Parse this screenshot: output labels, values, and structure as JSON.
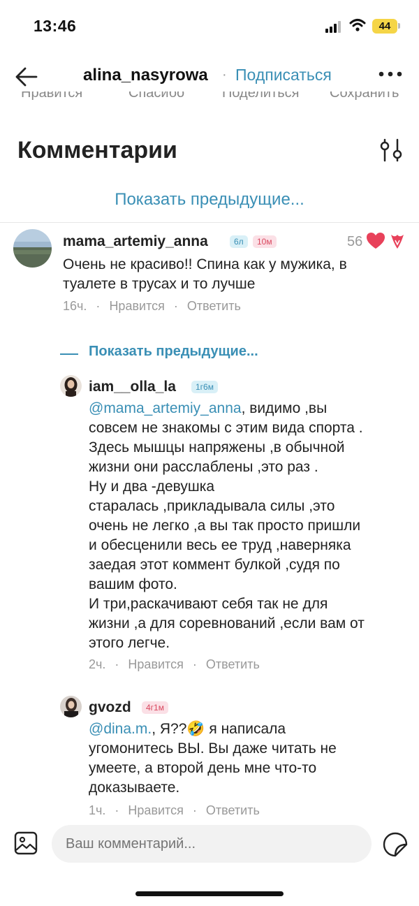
{
  "status_bar": {
    "time": "13:46",
    "battery": "44"
  },
  "header": {
    "username": "alina_nasyrowa",
    "separator": "·",
    "subscribe": "Подписаться"
  },
  "actions_strip": [
    "Нравится",
    "Спасибо",
    "Поделиться",
    "Сохранить"
  ],
  "comments_title": "Комментарии",
  "show_previous": "Показать предыдущие...",
  "main_comment": {
    "username": "mama_artemiy_anna",
    "badge_level": "6л",
    "badge_time": "10м",
    "likes": "56",
    "text": "Очень не красиво!! Спина как у мужика, в туалете в трусах и то лучше",
    "time": "16ч.",
    "like_label": "Нравится",
    "reply_label": "Ответить",
    "dot": "·"
  },
  "replies_toggle": "Показать предыдущие...",
  "reply1": {
    "username": "iam__olla_la",
    "badge": "1г6м",
    "mention": "@mama_artemiy_anna",
    "lines": [
      ", видимо ,вы",
      "совсем не знакомы с этим вида спорта .",
      "Здесь мышцы напряжены ,в обычной",
      "жизни они расслаблены ,это раз .",
      "Ну и два -девушка",
      "старалась ,прикладывала силы ,это",
      "очень не легко ,а вы так просто пришли",
      "и обесценили весь ее труд ,наверняка",
      "заедая этот коммент булкой ,судя по",
      "вашим фото.",
      "И три,раскачивают себя так не для",
      "жизни ,а для соревнований ,если вам от",
      "этого легче."
    ],
    "time": "2ч.",
    "like_label": "Нравится",
    "reply_label": "Ответить",
    "dot": "·"
  },
  "reply2": {
    "username": "gvozd",
    "badge": "4г1м",
    "mention": "@dina.m.",
    "line1_rest": ", Я??🤣 я написала",
    "lines": [
      "угомонитесь ВЫ. Вы даже читать не",
      "умеете, а второй день мне что-то",
      "доказываете."
    ],
    "time": "1ч.",
    "like_label": "Нравится",
    "reply_label": "Ответить",
    "dot": "·"
  },
  "composer": {
    "placeholder": "Ваш комментарий..."
  },
  "icons": [
    "back-arrow-icon",
    "more-icon",
    "filter-icon",
    "heart-icon",
    "tulip-icon",
    "image-icon",
    "sticker-icon",
    "signal-icon",
    "wifi-icon"
  ],
  "colors": {
    "accent": "#3a8fb5",
    "heart": "#e8415a",
    "badge_pink_text": "#d9485f"
  }
}
